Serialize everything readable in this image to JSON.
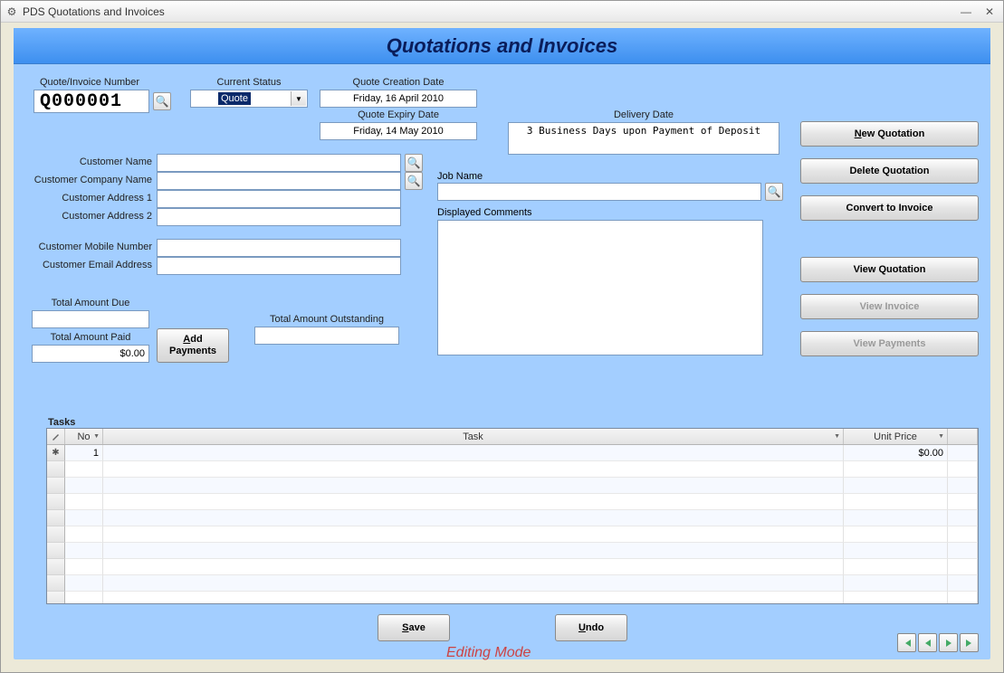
{
  "window": {
    "title": "PDS Quotations and Invoices"
  },
  "banner": {
    "title": "Quotations and Invoices"
  },
  "labels": {
    "quote_number": "Quote/Invoice Number",
    "current_status": "Current Status",
    "quote_creation_date": "Quote Creation Date",
    "quote_expiry_date": "Quote Expiry Date",
    "delivery_date": "Delivery Date",
    "customer_name": "Customer Name",
    "customer_company": "Customer Company Name",
    "customer_addr1": "Customer Address 1",
    "customer_addr2": "Customer Address 2",
    "customer_mobile": "Customer Mobile Number",
    "customer_email": "Customer Email Address",
    "job_name": "Job Name",
    "displayed_comments": "Displayed Comments",
    "total_due": "Total Amount Due",
    "total_paid": "Total Amount Paid",
    "total_outstanding": "Total Amount Outstanding",
    "tasks": "Tasks"
  },
  "values": {
    "quote_number": "Q000001",
    "status": "Quote",
    "creation_date": "Friday, 16 April 2010",
    "expiry_date": "Friday, 14 May 2010",
    "delivery_date": "3 Business Days upon Payment of Deposit",
    "customer_name": "",
    "customer_company": "",
    "customer_addr1": "",
    "customer_addr2": "",
    "customer_mobile": "",
    "customer_email": "",
    "job_name": "",
    "displayed_comments": "",
    "total_due": "",
    "total_paid": "$0.00",
    "total_outstanding": ""
  },
  "buttons": {
    "new_quotation_pre": "N",
    "new_quotation_rest": "ew Quotation",
    "delete_quotation": "Delete Quotation",
    "convert_invoice": "Convert to Invoice",
    "view_quotation": "View Quotation",
    "view_invoice": "View Invoice",
    "view_payments": "View Payments",
    "add_payments_pre": "A",
    "add_payments_rest": "dd",
    "add_payments_line2": "Payments",
    "save_pre": "S",
    "save_rest": "ave",
    "undo_pre": "U",
    "undo_rest": "ndo"
  },
  "grid": {
    "headers": {
      "no": "No",
      "task": "Task",
      "unit_price": "Unit Price"
    },
    "rows": [
      {
        "no": "1",
        "task": "",
        "unit_price": "$0.00"
      }
    ]
  },
  "mode": "Editing Mode"
}
